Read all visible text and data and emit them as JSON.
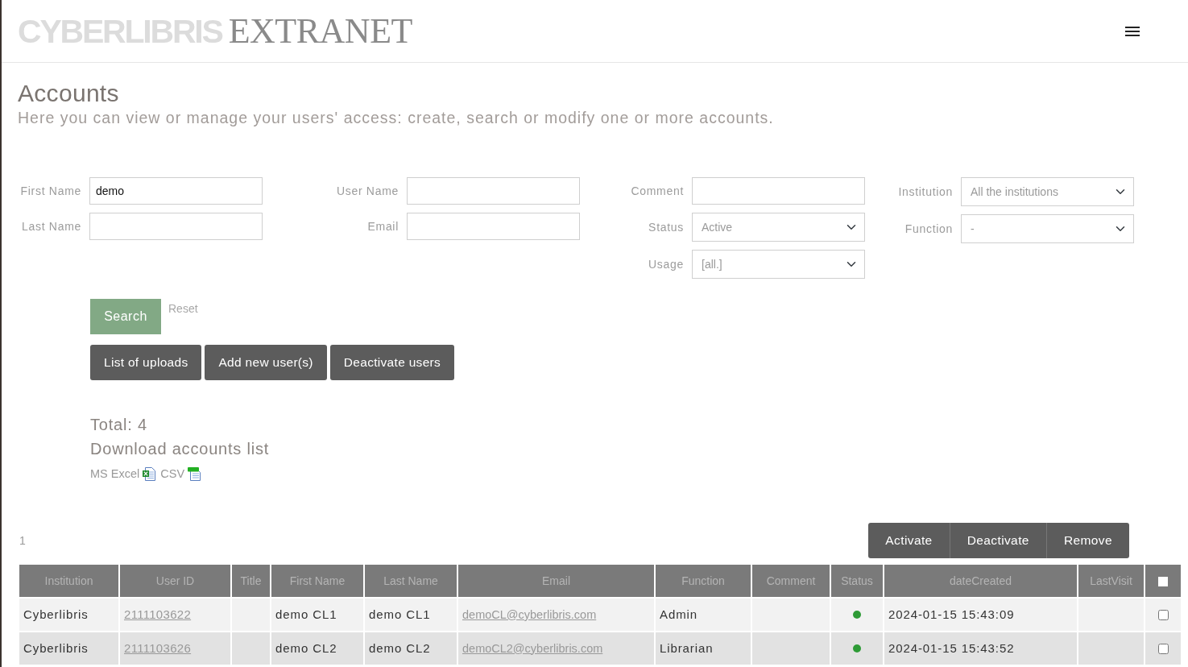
{
  "header": {
    "logo": {
      "primary": "CYBERLIBRIS",
      "secondary": "EXTRANET"
    }
  },
  "page": {
    "title": "Accounts",
    "subtitle": "Here you can view or manage your users' access: create, search or modify one or more accounts."
  },
  "filters": [
    {
      "fields": [
        {
          "label": "First Name",
          "kind": "text",
          "value": "demo"
        },
        {
          "label": "Last Name",
          "kind": "text"
        }
      ]
    },
    {
      "fields": [
        {
          "label": "User Name",
          "kind": "text"
        },
        {
          "label": "Email",
          "kind": "text"
        }
      ]
    },
    {
      "fields": [
        {
          "label": "Comment",
          "kind": "text"
        },
        {
          "label": "Status",
          "kind": "select",
          "value": "Active"
        },
        {
          "label": "Usage",
          "kind": "select",
          "value": "[all.]"
        }
      ]
    },
    {
      "fields": [
        {
          "label": "Institution",
          "kind": "select",
          "value": "All the institutions"
        },
        {
          "label": "Function",
          "kind": "select",
          "value": "-"
        }
      ]
    }
  ],
  "search_button": "Search",
  "reset_link": "Reset",
  "tool_buttons": [
    "List of uploads",
    "Add new user(s)",
    "Deactivate users"
  ],
  "summary": {
    "total": "Total: 4",
    "download_heading": "Download accounts list",
    "download_links": [
      {
        "label": "MS Excel",
        "kind": "excel"
      },
      {
        "label": "CSV",
        "kind": "csv"
      }
    ]
  },
  "pagination": [
    "1"
  ],
  "bulk_actions": [
    "Activate",
    "Deactivate",
    "Remove"
  ],
  "table": {
    "columns": [
      "Institution",
      "User ID",
      "Title",
      "First Name",
      "Last Name",
      "Email",
      "Function",
      "Comment",
      "Status",
      "dateCreated",
      "LastVisit"
    ],
    "select_all": {
      "checked": false
    },
    "rows": [
      {
        "institution": "Cyberlibris",
        "user_id": "2111103622",
        "first_name": "demo CL1",
        "last_name": "demo CL1",
        "email": "demoCL@cyberlibris.com",
        "function": "Admin",
        "status": {
          "color": "#2e9b36"
        },
        "date_created": "2024-01-15 15:43:09",
        "checked": false
      },
      {
        "institution": "Cyberlibris",
        "user_id": "2111103626",
        "first_name": "demo CL2",
        "last_name": "demo CL2",
        "email": "demoCL2@cyberlibris.com",
        "function": "Librarian",
        "status": {
          "color": "#2e9b36"
        },
        "date_created": "2024-01-15 15:43:52",
        "checked": false
      }
    ]
  }
}
